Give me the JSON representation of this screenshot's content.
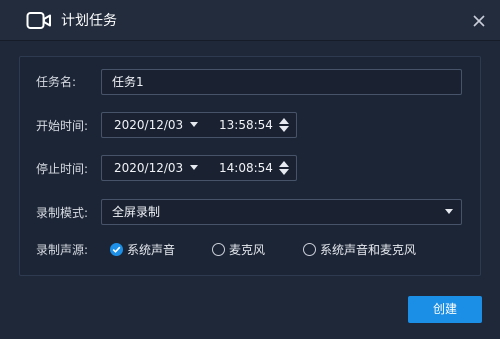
{
  "dialog": {
    "title": "计划任务",
    "title_icon": "camera-icon",
    "close_icon": "close-icon"
  },
  "form": {
    "task_name": {
      "label": "任务名:",
      "value": "任务1"
    },
    "start_time": {
      "label": "开始时间:",
      "date": "2020/12/03",
      "time": "13:58:54"
    },
    "stop_time": {
      "label": "停止时间:",
      "date": "2020/12/03",
      "time": "14:08:54"
    },
    "record_mode": {
      "label": "录制模式:",
      "value": "全屏录制"
    },
    "audio_source": {
      "label": "录制声源:",
      "options": [
        {
          "label": "系统声音",
          "checked": true
        },
        {
          "label": "麦克风",
          "checked": false
        },
        {
          "label": "系统声音和麦克风",
          "checked": false
        }
      ]
    }
  },
  "footer": {
    "create_label": "创建"
  },
  "colors": {
    "accent": "#1b8ee6",
    "background": "#1e2838",
    "titlebar": "#222c3d"
  }
}
